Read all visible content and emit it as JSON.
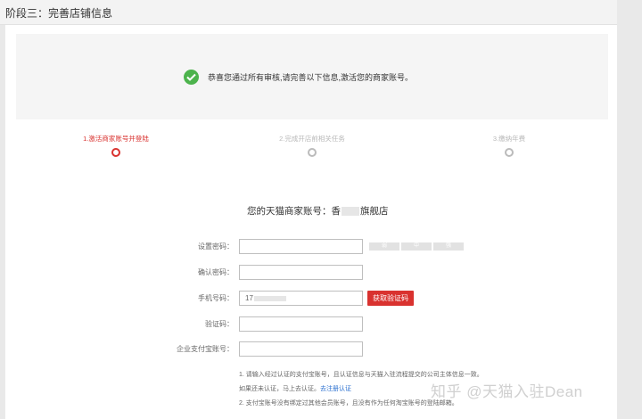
{
  "header": {
    "title": "阶段三：完善店铺信息"
  },
  "notice": {
    "icon": "check-circle-icon",
    "message": "恭喜您通过所有审核,请完善以下信息,激活您的商家账号。",
    "color": "#4cb34c"
  },
  "steps": [
    {
      "label": "1.激活商家账号并登陆",
      "active": true
    },
    {
      "label": "2.完成开店前相关任务",
      "active": false
    },
    {
      "label": "3.缴纳年费",
      "active": false
    }
  ],
  "account": {
    "prefix": "您的天猫商家账号：",
    "name_start": "香",
    "name_end": "旗舰店"
  },
  "form": {
    "password_label": "设置密码：",
    "confirm_label": "确认密码：",
    "phone_label": "手机号码：",
    "phone_value": "17",
    "sms_button": "获取验证码",
    "code_label": "验证码：",
    "alipay_label": "企业支付宝账号：",
    "strength": [
      "弱",
      "中",
      "强"
    ]
  },
  "notes": {
    "line1": "1. 请输入经过认证的支付宝账号，且认证信息与天猫入驻流程提交的公司主体信息一致。",
    "line2_text": "如果还未认证，马上去认证。",
    "line2_link": "去注册认证",
    "line3": "2. 支付宝账号没有绑定过其他会员账号，且没有作为任何淘宝账号的登陆邮箱。"
  },
  "watermark": "知乎 @天猫入驻Dean",
  "colors": {
    "accent": "#d9322f",
    "success": "#4cb34c",
    "link": "#2a6fcf"
  }
}
